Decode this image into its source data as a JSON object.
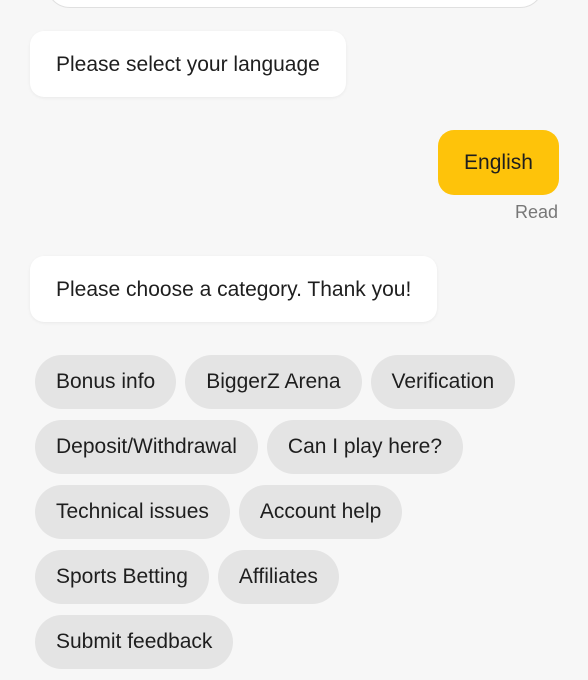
{
  "messages": {
    "bot_language_prompt": "Please select your language",
    "user_reply": "English",
    "read_status": "Read",
    "bot_category_prompt": "Please choose a category. Thank you!"
  },
  "chips": [
    [
      "Bonus info",
      "BiggerZ Arena",
      "Verification"
    ],
    [
      "Deposit/Withdrawal",
      "Can I play here?"
    ],
    [
      "Technical issues",
      "Account help"
    ],
    [
      "Sports Betting",
      "Affiliates"
    ],
    [
      "Submit feedback"
    ]
  ],
  "colors": {
    "accent": "#fec30a",
    "background": "#f7f7f7",
    "chip": "#e4e4e4"
  }
}
